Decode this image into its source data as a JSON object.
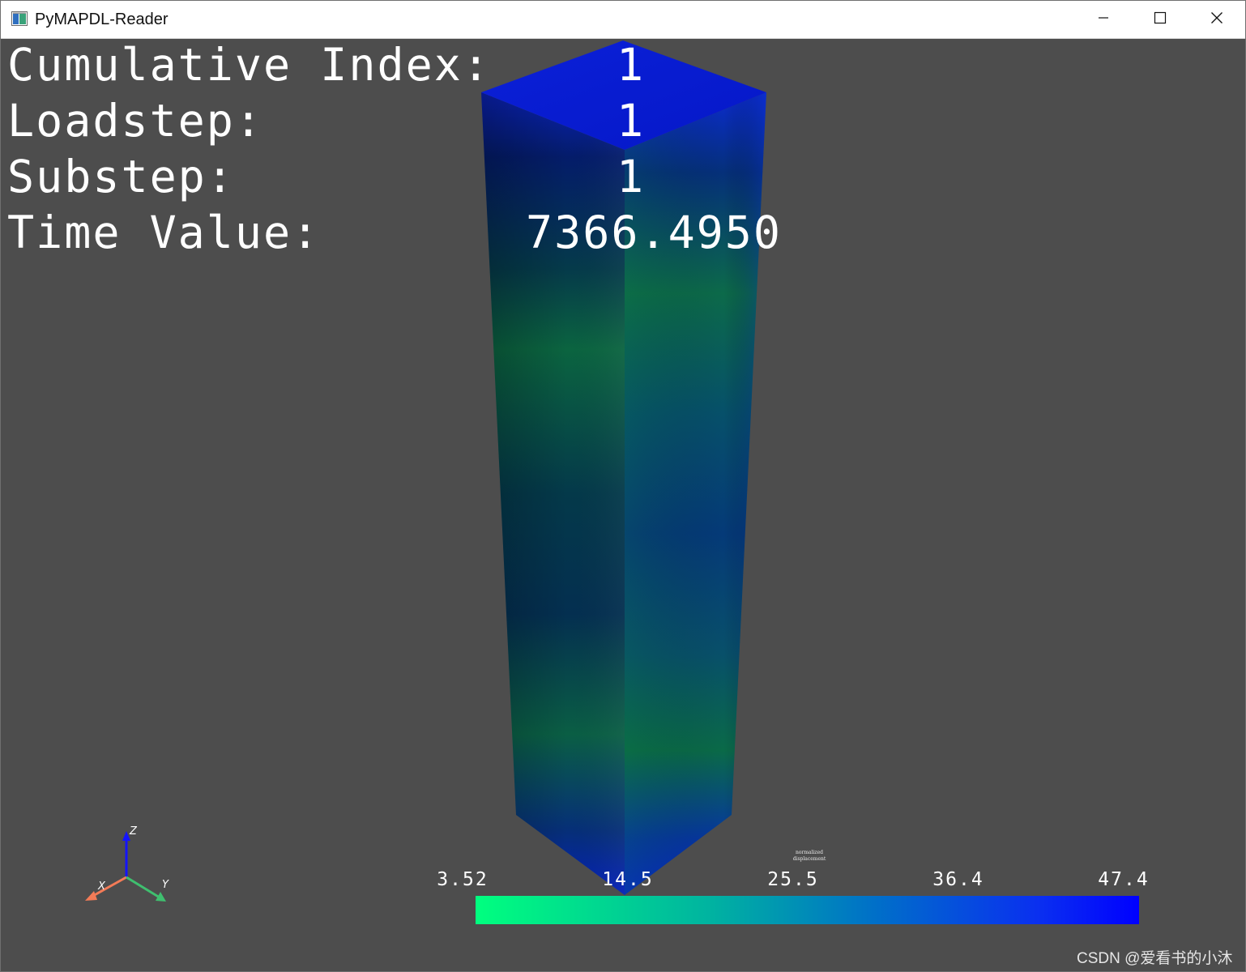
{
  "window": {
    "title": "PyMAPDL-Reader",
    "icon": "app-window-icon",
    "controls": [
      "minimize-icon",
      "maximize-icon",
      "close-icon"
    ]
  },
  "hud": {
    "cumulative_index_label": "Cumulative Index:",
    "cumulative_index_value": "1",
    "loadstep_label": "Loadstep:",
    "loadstep_value": "1",
    "substep_label": "Substep:",
    "substep_value": "1",
    "time_value_label": "Time Value:",
    "time_value_value": "7366.4950"
  },
  "scalar_bar": {
    "title": "normalized\ndisplacement",
    "ticks": [
      "3.52",
      "14.5",
      "25.5",
      "36.4",
      "47.4"
    ],
    "color_min": "#00ff7f",
    "color_max": "#0000ff"
  },
  "axes": {
    "x_label": "X",
    "y_label": "Y",
    "z_label": "Z",
    "x_color": "#f37b57",
    "y_color": "#3fbf6f",
    "z_color": "#1414ff"
  },
  "watermark": "CSDN @爱看书的小沐",
  "colors": {
    "background": "#4d4d4d",
    "text": "#ffffff"
  }
}
